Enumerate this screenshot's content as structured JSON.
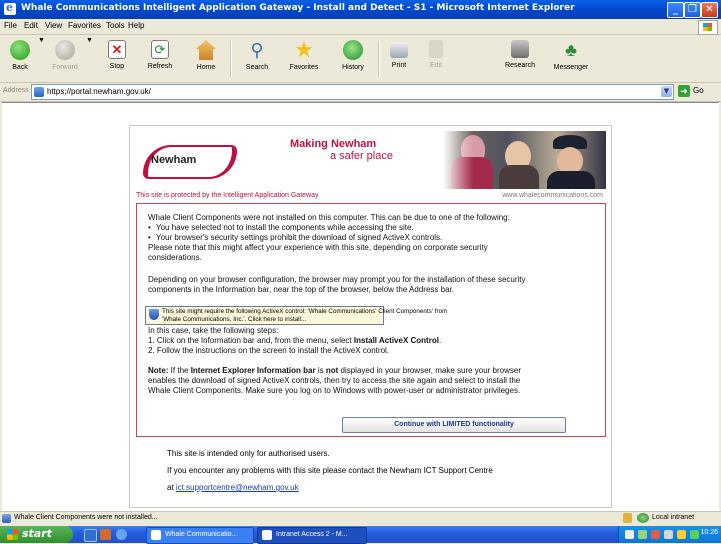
{
  "window": {
    "title": "Whale Communications Intelligent Application Gateway - Install and Detect - S1 - Microsoft Internet Explorer",
    "minimize": "_",
    "maximize": "❐",
    "close": "✕"
  },
  "menu": [
    "File",
    "Edit",
    "View",
    "Favorites",
    "Tools",
    "Help"
  ],
  "toolbar": {
    "back": "Back",
    "forward": "Forward",
    "stop": "Stop",
    "refresh": "Refresh",
    "home": "Home",
    "search": "Search",
    "favorites": "Favorites",
    "history": "History",
    "print": "Print",
    "edit": "Edit",
    "research": "Research",
    "messenger": "Messenger"
  },
  "address": {
    "label": "Address",
    "url": "https://portal.newham.gov.uk/",
    "go": "Go"
  },
  "page": {
    "logo_text": "Newham",
    "tagline_line1": "Making Newham",
    "tagline_line2": "a safer place",
    "protected_text": "This site is protected by the Intelligent Application Gateway",
    "site_url": "www.whalecommunications.com",
    "intro": "Whale Client Components were not installed on this computer. This can be due to one of the following:",
    "bullet1": "You have selected not to install the components while accessing the site.",
    "bullet2": "Your browser's security settings prohibit the download of signed ActiveX controls.",
    "note_line1": "Please note that this might affect your experience with this site, depending on corporate security",
    "note_line2": "considerations.",
    "depending_line1": "Depending on your browser configuration, the browser may prompt you for the installation of these security",
    "depending_line2": "components in the Information bar, near the top of the browser, below the Address bar.",
    "infobar_line1": "This site might require the following ActiveX control: 'Whale Communications' Client Components' from",
    "infobar_line2": "'Whale Communications, Inc.'. Click here to install...",
    "steps_intro": "In this case, take the following steps:",
    "step1_prefix": "1. Click on the Information bar and, from the menu, select ",
    "step1_bold": "Install ActiveX Control",
    "step1_suffix": ".",
    "step2": "2. Follow the instructions on the screen to install the ActiveX control.",
    "note_label": "Note:",
    "note_a": " If the ",
    "note_bold1": "Internet Explorer Information bar",
    "note_b": " is ",
    "note_bold2": "not",
    "note_c": " displayed in your browser, make sure your browser",
    "note2_line2": "enables the download of signed ActiveX controls, then try to access the site again and select to install the",
    "note2_line3": "Whale Client Components. Make sure you log on to Windows with power-user or administrator privileges.",
    "continue_button": "Continue with LIMITED functionality",
    "footer_line1": "This site is intended only for authorised users.",
    "footer_line2": "If you encounter any problems with this site please contact the Newham ICT Support Centre",
    "footer_at": "at ",
    "footer_email": "ict.supportcentre@newham.gov.uk"
  },
  "status": {
    "text": "Whale Client Components were not installed...",
    "zone": "Local intranet"
  },
  "taskbar": {
    "start": "start",
    "task1": "Whale Communicatio...",
    "task2": "Intranet Access 2 - M...",
    "clock": "10:26"
  }
}
